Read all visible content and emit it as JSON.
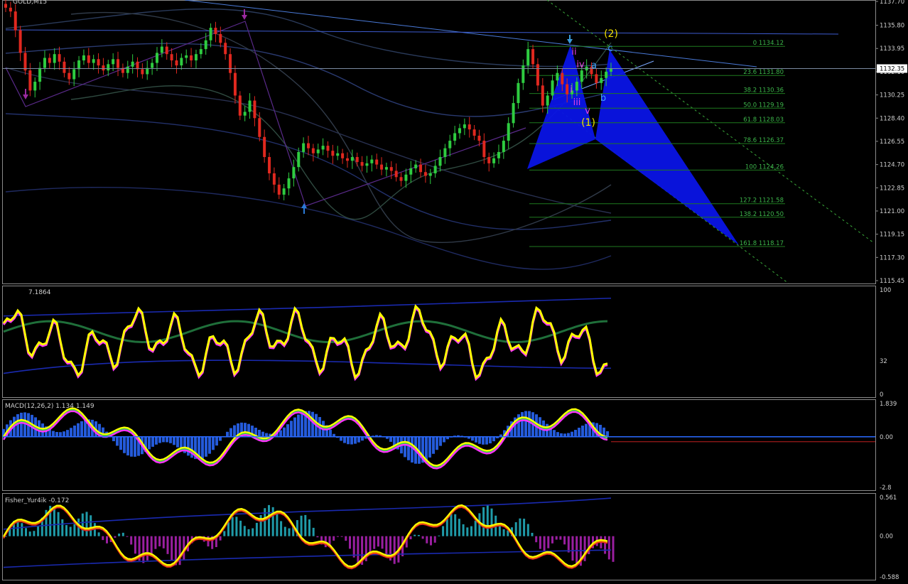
{
  "chart_data": [
    {
      "type": "candlestick",
      "panel": "price",
      "title": "GOLD,M15",
      "ylim": [
        1115.45,
        1137.7
      ],
      "y_ticks": [
        "1137.70",
        "1135.80",
        "1133.95",
        "1132.10",
        "1130.25",
        "1128.40",
        "1126.55",
        "1124.70",
        "1122.85",
        "1121.00",
        "1119.15",
        "1117.30",
        "1115.45"
      ],
      "current_price": "1132.35",
      "fib_levels": [
        {
          "label": "0 1134.12",
          "price": 1134.12
        },
        {
          "label": "23.6 1131.80",
          "price": 1131.8
        },
        {
          "label": "38.2 1130.36",
          "price": 1130.36
        },
        {
          "label": "50.0 1129.19",
          "price": 1129.19
        },
        {
          "label": "61.8 1128.03",
          "price": 1128.03
        },
        {
          "label": "78.6 1126.37",
          "price": 1126.37
        },
        {
          "label": "100 1124.26",
          "price": 1124.26
        },
        {
          "label": "127.2 1121.58",
          "price": 1121.58
        },
        {
          "label": "138.2 1120.50",
          "price": 1120.5
        },
        {
          "label": "161.8 1118.17",
          "price": 1118.17
        }
      ],
      "wave_labels_primary": [
        "(1)",
        "(2)"
      ],
      "wave_labels_minor": [
        "i",
        "ii",
        "iii",
        "iv",
        "v"
      ],
      "wave_labels_correction": [
        "a",
        "b",
        "c"
      ],
      "close_series": [
        1137.2,
        1136.9,
        1135.4,
        1133.6,
        1132.2,
        1130.6,
        1131.3,
        1132.4,
        1133.2,
        1132.8,
        1133.5,
        1132.9,
        1132.0,
        1131.5,
        1132.3,
        1133.0,
        1133.4,
        1132.8,
        1133.1,
        1132.6,
        1132.2,
        1132.7,
        1133.1,
        1132.4,
        1132.0,
        1132.5,
        1132.9,
        1132.3,
        1131.9,
        1132.4,
        1132.8,
        1133.6,
        1134.1,
        1133.5,
        1133.0,
        1132.6,
        1133.2,
        1133.4,
        1133.0,
        1133.5,
        1133.9,
        1134.6,
        1135.6,
        1135.1,
        1134.4,
        1133.5,
        1132.0,
        1130.2,
        1128.6,
        1128.9,
        1129.8,
        1128.4,
        1126.9,
        1125.3,
        1124.0,
        1123.1,
        1122.3,
        1122.8,
        1123.6,
        1124.5,
        1125.7,
        1126.4,
        1126.0,
        1125.6,
        1125.9,
        1126.2,
        1125.8,
        1125.4,
        1125.6,
        1125.2,
        1125.0,
        1125.3,
        1124.9,
        1124.6,
        1124.8,
        1125.1,
        1124.7,
        1124.3,
        1124.5,
        1124.2,
        1123.7,
        1123.4,
        1123.9,
        1124.4,
        1124.7,
        1124.1,
        1123.8,
        1124.0,
        1124.6,
        1125.3,
        1126.0,
        1126.6,
        1127.2,
        1127.6,
        1127.9,
        1127.5,
        1127.0,
        1126.6,
        1125.3,
        1124.8,
        1125.2,
        1125.7,
        1126.6,
        1128.0,
        1129.6,
        1131.2,
        1132.6,
        1133.9,
        1132.7,
        1131.0,
        1129.4,
        1130.2,
        1131.4,
        1132.0,
        1131.1,
        1130.3,
        1130.6,
        1131.3,
        1132.2,
        1132.5,
        1131.9,
        1131.2,
        1131.6,
        1132.1,
        1132.35
      ]
    },
    {
      "type": "line",
      "panel": "oscillator",
      "title": "7.1864",
      "ylim": [
        0,
        100
      ],
      "y_ticks": [
        "100",
        "32",
        "0"
      ]
    },
    {
      "type": "line",
      "panel": "macd",
      "title": "MACD(12,26,2) 1.134 1.149",
      "ylim": [
        -2.8,
        1.839
      ],
      "y_ticks": [
        "1.839",
        "0.00",
        "-2.8"
      ]
    },
    {
      "type": "bar",
      "panel": "fisher",
      "title": "Fisher_Yur4ik -0.172",
      "ylim": [
        -0.588,
        0.561
      ],
      "y_ticks": [
        "0.561",
        "0.00",
        "-0.588"
      ]
    }
  ],
  "colors": {
    "bull": "#2ecc40",
    "bear": "#e0281f",
    "fib": "#1f7a1f",
    "pattern": "#0a14e6",
    "wave_primary": "#f0e000",
    "wave_minor": "#e040e0",
    "wave_correction": "#40a0ff",
    "osc_main": "#ffff00",
    "osc_signal": "#ff33ff",
    "macd_hist": "#2a6aff",
    "fisher_pos": "#1f9aa8",
    "fisher_neg": "#9a1fa0"
  }
}
